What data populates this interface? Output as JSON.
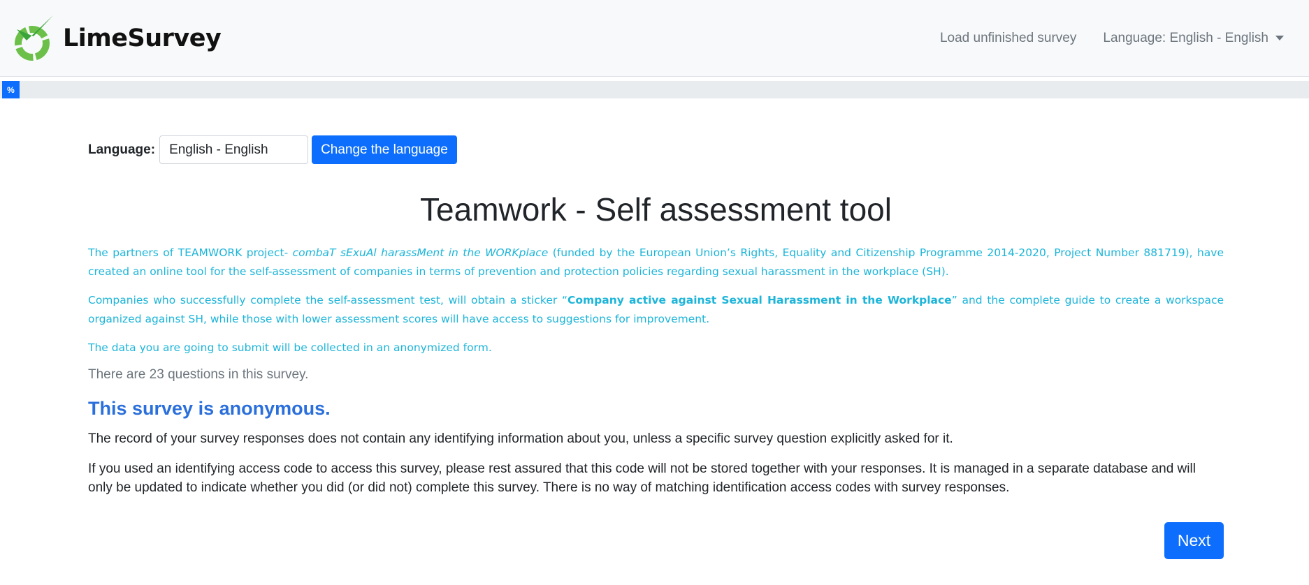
{
  "brand": {
    "name": "LimeSurvey"
  },
  "nav": {
    "load_unfinished": "Load unfinished survey",
    "language": "Language: English - English"
  },
  "progress": {
    "label": "%",
    "percent": 0
  },
  "language_switch": {
    "label": "Language:",
    "selected": "English - English",
    "button": "Change the language"
  },
  "survey": {
    "title": "Teamwork - Self assessment tool",
    "desc1": {
      "prefix": "The partners of TEAMWORK project- ",
      "italic": "combaT sExuAl harassMent in the WORKplace",
      "suffix": " (funded by the European Union’s Rights, Equality and Citizenship Programme 2014-2020, Project Number 881719), have created an online tool for the self-assessment of companies in terms of prevention and protection policies regarding sexual harassment in the workplace (SH)."
    },
    "desc2": {
      "prefix": "Companies who successfully complete the self-assessment test, will obtain a sticker “",
      "bold": "Company active against Sexual Harassment in the Workplace",
      "suffix": "” and the complete guide to create a workspace organized against SH, while those with lower assessment scores will have access to suggestions for improvement."
    },
    "desc3": "The data you are going to submit will be collected in an anonymized form.",
    "question_count": "There are 23 questions in this survey.",
    "anonymous_title": "This survey is anonymous.",
    "anonymous_text1": "The record of your survey responses does not contain any identifying information about you, unless a specific survey question explicitly asked for it.",
    "anonymous_text2": "If you used an identifying access code to access this survey, please rest assured that this code will not be stored together with your responses. It is managed in a separate database and will only be updated to indicate whether you did (or did not) complete this survey. There is no way of matching identification access codes with survey responses."
  },
  "next_button": "Next",
  "colors": {
    "primary": "#0d6efd",
    "description": "#1cb5d9",
    "anonymous_title": "#2a6fdb",
    "logo_green": "#6cc04a"
  }
}
